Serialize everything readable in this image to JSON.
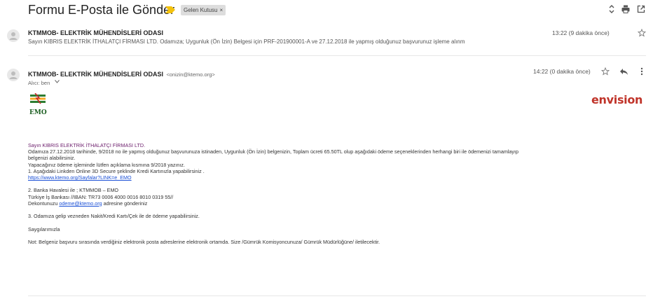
{
  "subject": "Formu E-Posta ile Gönder",
  "label": "Gelen Kutusu",
  "label_close": "×",
  "msg1": {
    "sender": "KTMMOB- ELEKTRİK MÜHENDİSLERİ ODASI",
    "snippet": "Sayın KIBRIS ELEKTRİK İTHALATÇI FİRMASI LTD. Odamıza; Uygunluk (Ön İzin) Belgesi için PRF-201900001-A ve 27.12.2018 ile yapmış olduğunuz başvurunuz işleme alınm",
    "time": "13:22 (9 dakika önce)"
  },
  "msg2": {
    "sender": "KTMMOB- ELEKTRİK MÜHENDİSLERİ ODASI",
    "email": "<onizin@ktemo.org>",
    "to": "Alıcı: ben",
    "time": "14:22 (0 dakika önce)"
  },
  "logos": {
    "left": "EMO",
    "right": "envision"
  },
  "body": {
    "greeting": "Sayın KIBRIS ELEKTRİK İTHALATÇI FİRMASI LTD.",
    "line1": "Odamıza 27.12.2018 tarihinde, 9/2018 no ile yapmış olduğunuz başvurunuza istinaden, Uygunluk (Ön İzin) belgenizin, Toplam ücreti 65.50TL olup aşağıdaki ödeme seçeneklerinden herhangi biri ile ödemenizi tamamlayıp",
    "line2": "belgenizi alabilirsiniz.",
    "line3": "Yapacağınız ödeme işleminde lütfen açıklama kısmına 9/2018 yazınız.",
    "line4": "1. Aşağıdaki Linkden Online 3D Secure şeklinde Kredi Kartınızla yapabilirsiniz .",
    "link1": "https://www.ktemo.org/Sayfalar?LINK=e_EMO",
    "line5": "2. Banka Havalesi ile ; KTMMOB – EMO",
    "line6": "Türkiye İş Bankası //IBAN: TR73 0006 4000 0016 8010 0319 55//",
    "line7_pre": "Dekontunuzu ",
    "line7_link": "odeme@ktemo.org",
    "line7_post": " adresine gönderiniz",
    "line8": "3. Odamıza gelip vezneden Nakit/Kredi Kartı/Çek ile de ödeme yapabilirsiniz.",
    "line9": "Saygılarımızla",
    "line10": "Not: Belgeniz başvuru sırasında verdiğiniz elektronik posta adreslerine elektronik ortamda. Size /Gümrük Komisyoncunuza/ Gümrük Müdürlüğüne/ iletilecektir."
  },
  "icons": {
    "important": "important-marker-icon",
    "expand": "expand-all-icon",
    "print": "print-icon",
    "new_window": "new-window-icon",
    "star": "star-icon",
    "reply": "reply-icon",
    "more": "more-vert-icon",
    "dropdown": "chevron-down-icon"
  },
  "colors": {
    "important": "#f4c20d",
    "greeting": "#6a1b6a",
    "link": "#1a4fd6",
    "brand_right": "#c0342a"
  }
}
